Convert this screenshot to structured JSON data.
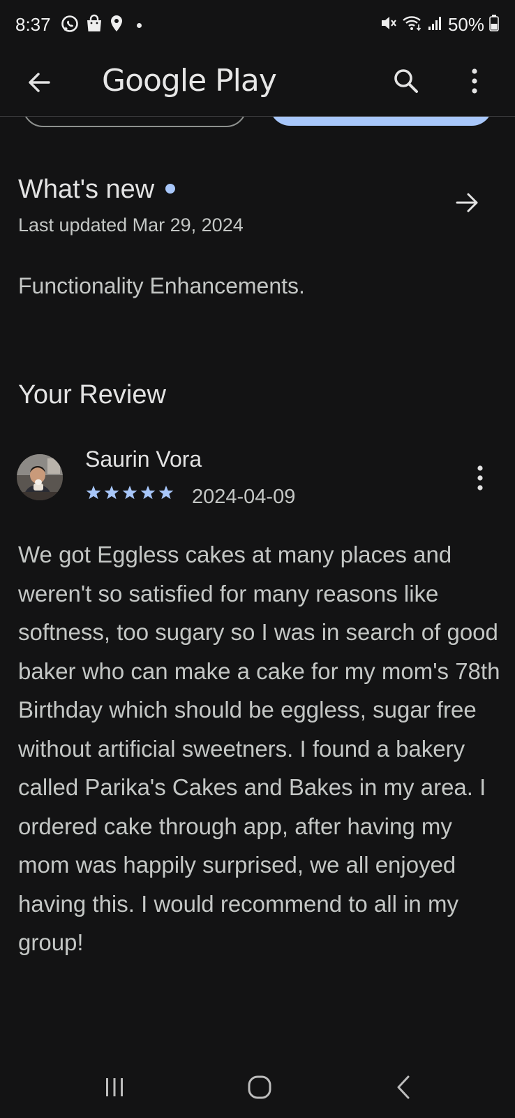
{
  "status_bar": {
    "time": "8:37",
    "battery": "50%",
    "icons_left": [
      "whatsapp-icon",
      "shopping-bag-icon",
      "location-icon"
    ],
    "icons_right": [
      "mute-icon",
      "wifi-icon",
      "signal-icon",
      "battery-icon"
    ]
  },
  "app_bar": {
    "title": "Google Play"
  },
  "whats_new": {
    "title": "What's new",
    "last_updated": "Last updated Mar 29, 2024",
    "body": "Functionality Enhancements.",
    "accent_color": "#a8c7fa"
  },
  "your_review": {
    "section_title": "Your Review",
    "reviewer_name": "Saurin Vora",
    "rating": 5,
    "rating_max": 5,
    "date": "2024-04-09",
    "text": "We got Eggless cakes at many places and weren't so satisfied for many reasons like softness, too sugary so I was in search of good baker who can make a cake for my mom's 78th Birthday which should be eggless, sugar free without artificial sweetners. I found a bakery called Parika's Cakes and Bakes in my area. I ordered cake through app, after having my mom was happily surprised, we all enjoyed having this. I would recommend to all in my group!",
    "star_color": "#a8c7fa"
  },
  "nav_bar": {
    "buttons": [
      "recent-apps-icon",
      "home-icon",
      "back-icon"
    ]
  }
}
